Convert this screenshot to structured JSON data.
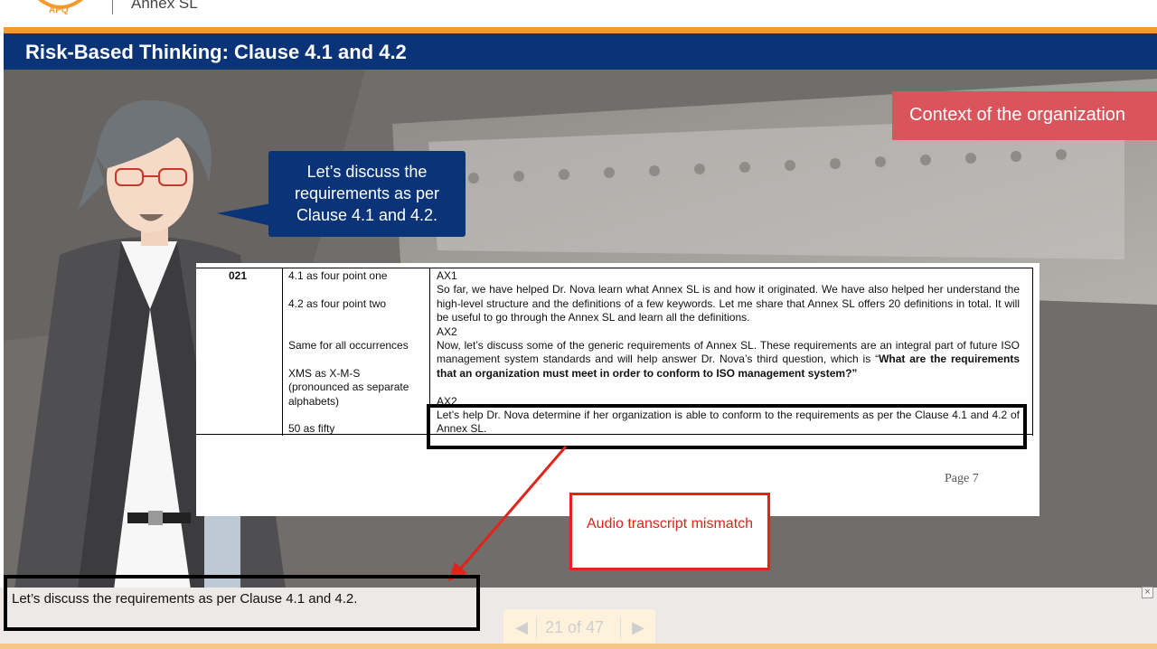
{
  "header": {
    "course_title": "Annex SL",
    "slide_title": "Risk-Based Thinking: Clause 4.1 and 4.2"
  },
  "stage": {
    "context_tag": "Context of the organization",
    "speech_bubble": "Let’s discuss the requirements as per Clause 4.1 and 4.2."
  },
  "script_doc": {
    "scene_number": "021",
    "pronunciations": [
      "4.1 as four point one",
      "4.2 as four point two",
      "Same for all occurrences",
      "XMS as X-M-S",
      "(pronounced as separate",
      "alphabets)",
      "50 as fifty"
    ],
    "lines": [
      "AX1",
      "So far, we have helped Dr. Nova learn what Annex SL is and how it originated. We have also helped her understand the high-level structure and the definitions of a few keywords. Let me share that Annex SL offers 20 definitions in total. It will be useful to go through the Annex SL and learn all the definitions.",
      "AX2",
      "Now, let’s discuss some of the generic requirements of Annex SL. These requirements are an integral part of future ISO management system standards and will help answer Dr. Nova’s third question, which is “",
      "What are the requirements that an organization must meet in order to conform to ISO management system?”",
      "AX2",
      "Let’s help Dr. Nova determine if her organization is able to conform to the requirements as per the Clause 4.1 and 4.2 of Annex SL."
    ],
    "page_label": "Page 7"
  },
  "annotation": {
    "label": "Audio transcript mismatch"
  },
  "caption": {
    "text": "Let’s discuss the requirements as per Clause 4.1 and 4.2."
  },
  "nav": {
    "prev_icon": "◀",
    "next_icon": "▶",
    "counter": "21 of 47"
  },
  "close_icon": "×",
  "colors": {
    "brand_blue": "#0b3478",
    "accent_orange": "#f29a2e",
    "context_red": "#d9555b",
    "annotation_red": "#e2231a"
  }
}
